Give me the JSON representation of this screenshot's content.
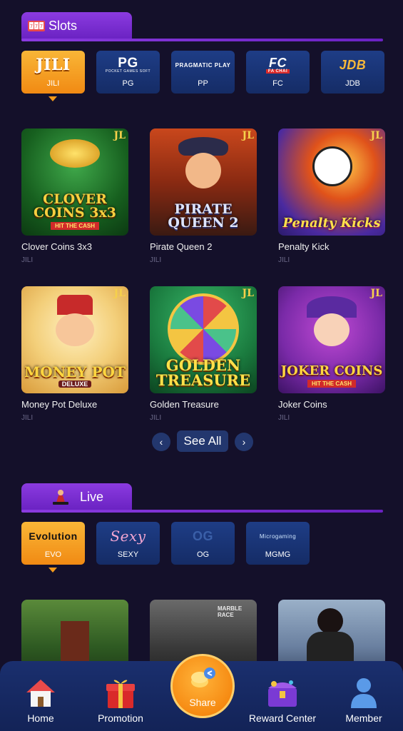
{
  "slots": {
    "title": "Slots",
    "providers": [
      {
        "logo": "JILI",
        "label": "JILI",
        "active": true
      },
      {
        "logo": "PG",
        "sub": "POCKET GAMES SOFT",
        "label": "PG"
      },
      {
        "logo": "PRAGMATIC PLAY",
        "label": "PP"
      },
      {
        "logo": "FC",
        "sub": "FA CHAI",
        "label": "FC"
      },
      {
        "logo": "JDB",
        "label": "JDB"
      }
    ],
    "games": [
      {
        "name": "Clover Coins 3x3",
        "provider": "JILI",
        "badge": "JL",
        "art": "CLOVER COINS 3x3",
        "art_sub": "HIT THE CASH"
      },
      {
        "name": "Pirate Queen 2",
        "provider": "JILI",
        "badge": "JL",
        "art": "PIRATE QUEEN 2",
        "art_sub": ""
      },
      {
        "name": "Penalty Kick",
        "provider": "JILI",
        "badge": "JL",
        "art": "Penalty Kicks",
        "art_sub": ""
      },
      {
        "name": "Money Pot Deluxe",
        "provider": "JILI",
        "badge": "JL",
        "art": "MONEY POT",
        "art_sub": "DELUXE"
      },
      {
        "name": "Golden Treasure",
        "provider": "JILI",
        "badge": "JL",
        "art": "GOLDEN TREASURE",
        "art_sub": ""
      },
      {
        "name": "Joker Coins",
        "provider": "JILI",
        "badge": "JL",
        "art": "JOKER COINS",
        "art_sub": "HIT THE CASH"
      }
    ],
    "see_all": "See All",
    "prev": "‹",
    "next": "›"
  },
  "live": {
    "title": "Live",
    "providers": [
      {
        "logo": "Evolution",
        "label": "EVO",
        "active": true
      },
      {
        "logo": "Sexy",
        "label": "SEXY"
      },
      {
        "logo": "OG",
        "label": "OG"
      },
      {
        "logo": "Microgaming",
        "label": "MGMG"
      }
    ],
    "thumb_caption": "MARBLE RACE"
  },
  "bottom_nav": {
    "home": "Home",
    "promotion": "Promotion",
    "share": "Share",
    "reward": "Reward Center",
    "member": "Member"
  },
  "colors": {
    "background": "#14102a",
    "section_purple": "#7a2fd4",
    "provider_blue": "#1e3d86",
    "active_orange": "#f39a1c",
    "nav_blue": "#1a2f6e"
  }
}
